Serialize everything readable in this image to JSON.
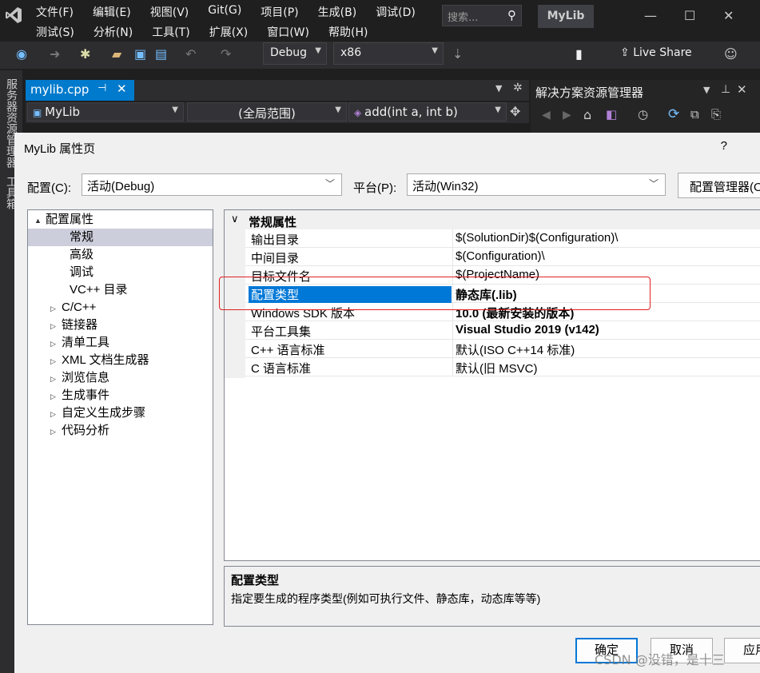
{
  "app": {
    "menu_row1": [
      "文件(F)",
      "编辑(E)",
      "视图(V)",
      "Git(G)",
      "项目(P)",
      "生成(B)",
      "调试(D)"
    ],
    "menu_row2": [
      "测试(S)",
      "分析(N)",
      "工具(T)",
      "扩展(X)",
      "窗口(W)",
      "帮助(H)"
    ],
    "search_placeholder": "搜索...",
    "solution_name": "MyLib"
  },
  "toolbar": {
    "configuration": "Debug",
    "platform": "x86",
    "live_share_label": "Live Share"
  },
  "side_strip": {
    "server_explorer": "服务器资源管理器",
    "toolbox": "工具箱"
  },
  "editor": {
    "tab_label": "mylib.cpp",
    "nav_project": "MyLib",
    "nav_scope": "(全局范围)",
    "nav_member": "add(int a, int b)"
  },
  "solution_explorer": {
    "title": "解决方案资源管理器"
  },
  "dialog": {
    "title": "MyLib 属性页",
    "help": "?",
    "config_label": "配置(C):",
    "config_value": "活动(Debug)",
    "platform_label": "平台(P):",
    "platform_value": "活动(Win32)",
    "config_manager_button": "配置管理器(O)...",
    "tree": [
      {
        "label": "配置属性",
        "indent": 0,
        "twisty": "▲"
      },
      {
        "label": "常规",
        "indent": 1,
        "selected": true
      },
      {
        "label": "高级",
        "indent": 1
      },
      {
        "label": "调试",
        "indent": 1
      },
      {
        "label": "VC++ 目录",
        "indent": 1
      },
      {
        "label": "C/C++",
        "indent": 1,
        "twisty": "▷"
      },
      {
        "label": "链接器",
        "indent": 1,
        "twisty": "▷"
      },
      {
        "label": "清单工具",
        "indent": 1,
        "twisty": "▷"
      },
      {
        "label": "XML 文档生成器",
        "indent": 1,
        "twisty": "▷"
      },
      {
        "label": "浏览信息",
        "indent": 1,
        "twisty": "▷"
      },
      {
        "label": "生成事件",
        "indent": 1,
        "twisty": "▷"
      },
      {
        "label": "自定义生成步骤",
        "indent": 1,
        "twisty": "▷"
      },
      {
        "label": "代码分析",
        "indent": 1,
        "twisty": "▷"
      }
    ],
    "grid_category": "常规属性",
    "properties": [
      {
        "name": "输出目录",
        "value": "$(SolutionDir)$(Configuration)\\",
        "bold": false
      },
      {
        "name": "中间目录",
        "value": "$(Configuration)\\",
        "bold": false
      },
      {
        "name": "目标文件名",
        "value": "$(ProjectName)",
        "bold": false
      },
      {
        "name": "配置类型",
        "value": "静态库(.lib)",
        "bold": true,
        "selected": true
      },
      {
        "name": "Windows SDK 版本",
        "value": "10.0 (最新安装的版本)",
        "bold": true
      },
      {
        "name": "平台工具集",
        "value": "Visual Studio 2019 (v142)",
        "bold": true
      },
      {
        "name": "C++ 语言标准",
        "value": "默认(ISO C++14 标准)",
        "bold": false
      },
      {
        "name": "C 语言标准",
        "value": "默认(旧 MSVC)",
        "bold": false
      }
    ],
    "description_title": "配置类型",
    "description_text": "指定要生成的程序类型(例如可执行文件、静态库，动态库等等)",
    "ok_button": "确定",
    "cancel_button": "取消",
    "apply_button": "应用"
  },
  "watermark": "CSDN @没错，是十三"
}
